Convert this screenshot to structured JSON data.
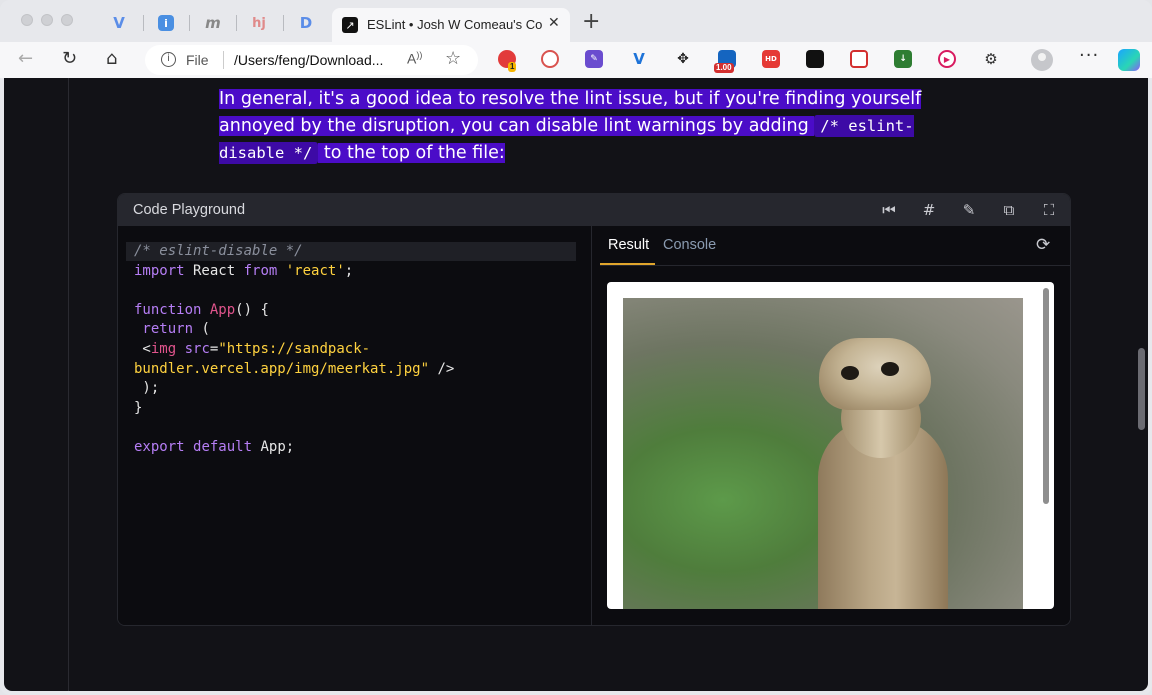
{
  "browser": {
    "pinned_tabs": [
      {
        "icon": "vee-icon",
        "glyph": "V",
        "color": "#5b8de8"
      },
      {
        "icon": "info-tab-icon",
        "glyph": "i",
        "color": "#4a8fe2"
      },
      {
        "icon": "m-tab-icon",
        "glyph": "m",
        "color": "#888888"
      },
      {
        "icon": "hj-tab-icon",
        "glyph": "hj",
        "color": "#e08a8a"
      },
      {
        "icon": "d-tab-icon",
        "glyph": "D",
        "color": "#5b8de8"
      }
    ],
    "active_tab": {
      "title": "ESLint • Josh W Comeau's Course Platform",
      "favicon_glyph": "↗"
    },
    "close_glyph": "✕",
    "new_tab_glyph": "+",
    "address": {
      "scheme": "File",
      "url": "/Users/feng/Download...",
      "read_aloud": "A",
      "star_glyph": "☆"
    },
    "nav": {
      "back": "←",
      "reload": "↻",
      "home": "⌂"
    },
    "extensions": [
      {
        "name": "record-extension-icon",
        "color": "#e23b3b",
        "badge": "1"
      },
      {
        "name": "search-extension-icon",
        "color": "#d9534f"
      },
      {
        "name": "edit-extension-icon",
        "color": "#6a4ccf"
      },
      {
        "name": "vee-extension-icon",
        "color": "#1e73d8"
      },
      {
        "name": "move-extension-icon",
        "color": "#222222"
      },
      {
        "name": "speed-extension-icon",
        "color": "#1565c0",
        "badge": "1.00"
      },
      {
        "name": "hd-extension-icon",
        "color": "#e53935",
        "label": "HD"
      },
      {
        "name": "tiles-extension-icon",
        "color": "#111111"
      },
      {
        "name": "camera-extension-icon",
        "color": "#d32f2f"
      },
      {
        "name": "download-extension-icon",
        "color": "#2e7d32"
      },
      {
        "name": "play-extension-icon",
        "color": "#d81b60"
      },
      {
        "name": "puzzle-extension-icon",
        "color": "#333333"
      }
    ],
    "more_glyph": "···"
  },
  "article": {
    "segments": [
      {
        "text": "In general, it's a good idea to resolve the lint issue, but if you're finding yourself annoyed by the disruption, you can disable lint warnings by adding ",
        "code": false
      },
      {
        "text": "/* eslint-disable */",
        "code": true
      },
      {
        "text": " to the top of the file:",
        "code": false
      }
    ]
  },
  "playground": {
    "title": "Code Playground",
    "buttons": [
      {
        "name": "reset-icon",
        "glyph": "⏮"
      },
      {
        "name": "format-icon",
        "glyph": "#"
      },
      {
        "name": "edit-icon",
        "glyph": "✎"
      },
      {
        "name": "open-external-icon",
        "glyph": "⧉"
      },
      {
        "name": "fullscreen-icon",
        "glyph": "⛶"
      }
    ],
    "code_lines": [
      [
        {
          "t": "/* eslint-disable */",
          "c": "tk-comment"
        }
      ],
      [
        {
          "t": "import",
          "c": "tk-kw"
        },
        {
          "t": " React ",
          "c": "tk-plain"
        },
        {
          "t": "from",
          "c": "tk-kw"
        },
        {
          "t": " ",
          "c": "tk-plain"
        },
        {
          "t": "'react'",
          "c": "tk-str"
        },
        {
          "t": ";",
          "c": "tk-plain"
        }
      ],
      [],
      [
        {
          "t": "function",
          "c": "tk-kw"
        },
        {
          "t": " ",
          "c": "tk-plain"
        },
        {
          "t": "App",
          "c": "tk-fn"
        },
        {
          "t": "() {",
          "c": "tk-plain"
        }
      ],
      [
        {
          "t": " return",
          "c": "tk-kw"
        },
        {
          "t": " (",
          "c": "tk-plain"
        }
      ],
      [
        {
          "t": " <",
          "c": "tk-plain"
        },
        {
          "t": "img",
          "c": "tk-tag"
        },
        {
          "t": " ",
          "c": "tk-plain"
        },
        {
          "t": "src",
          "c": "tk-attr"
        },
        {
          "t": "=",
          "c": "tk-plain"
        },
        {
          "t": "\"https://sandpack-",
          "c": "tk-str"
        }
      ],
      [
        {
          "t": "bundler.vercel.app/img/meerkat.jpg\"",
          "c": "tk-str"
        },
        {
          "t": " />",
          "c": "tk-plain"
        }
      ],
      [
        {
          "t": " );",
          "c": "tk-plain"
        }
      ],
      [
        {
          "t": "}",
          "c": "tk-plain"
        }
      ],
      [],
      [
        {
          "t": "export",
          "c": "tk-kw"
        },
        {
          "t": " ",
          "c": "tk-plain"
        },
        {
          "t": "default",
          "c": "tk-kw"
        },
        {
          "t": " App;",
          "c": "tk-plain"
        }
      ]
    ],
    "preview_tabs": [
      {
        "label": "Result",
        "active": true
      },
      {
        "label": "Console",
        "active": false
      }
    ],
    "refresh_glyph": "⟳"
  },
  "colors": {
    "highlight": "#4b0cc8",
    "accent_underline": "#e0a52c",
    "page_bg": "#121217"
  }
}
